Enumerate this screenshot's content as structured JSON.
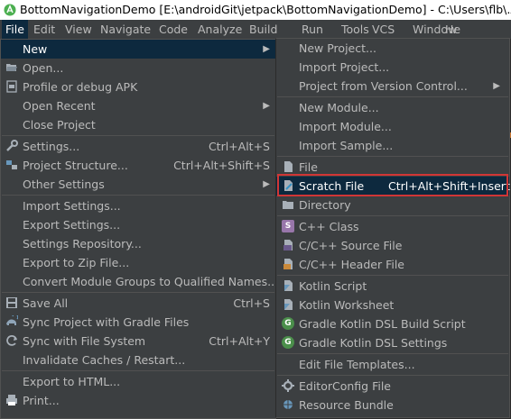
{
  "window": {
    "title": "BottomNavigationDemo [E:\\androidGit\\jetpack\\BottomNavigationDemo] - C:\\Users\\flb\\.Andro"
  },
  "menubar": {
    "items": [
      "File",
      "Edit",
      "View",
      "Navigate",
      "Code",
      "Analyze",
      "Build",
      "Run",
      "Tools",
      "VCS",
      "Window",
      "He"
    ]
  },
  "file_menu": {
    "items": [
      {
        "label": "New",
        "icon": "none",
        "submenu": true
      },
      {
        "label": "Open...",
        "icon": "folder-open-icon"
      },
      {
        "label": "Profile or debug APK",
        "icon": "apk-icon"
      },
      {
        "label": "Open Recent",
        "icon": "none",
        "submenu": true
      },
      {
        "label": "Close Project",
        "icon": "none"
      },
      {
        "label": "Settings...",
        "icon": "wrench-icon",
        "shortcut": "Ctrl+Alt+S"
      },
      {
        "label": "Project Structure...",
        "icon": "project-structure-icon",
        "shortcut": "Ctrl+Alt+Shift+S"
      },
      {
        "label": "Other Settings",
        "icon": "none",
        "submenu": true
      },
      {
        "label": "Import Settings...",
        "icon": "none"
      },
      {
        "label": "Export Settings...",
        "icon": "none"
      },
      {
        "label": "Settings Repository...",
        "icon": "none"
      },
      {
        "label": "Export to Zip File...",
        "icon": "none"
      },
      {
        "label": "Convert Module Groups to Qualified Names...",
        "icon": "none"
      },
      {
        "label": "Save All",
        "icon": "save-icon",
        "shortcut": "Ctrl+S"
      },
      {
        "label": "Sync Project with Gradle Files",
        "icon": "gradle-sync-icon"
      },
      {
        "label": "Sync with File System",
        "icon": "refresh-icon",
        "shortcut": "Ctrl+Alt+Y"
      },
      {
        "label": "Invalidate Caches / Restart...",
        "icon": "none"
      },
      {
        "label": "Export to HTML...",
        "icon": "none"
      },
      {
        "label": "Print...",
        "icon": "print-icon"
      }
    ]
  },
  "new_menu": {
    "items": [
      {
        "label": "New Project...",
        "icon": "none"
      },
      {
        "label": "Import Project...",
        "icon": "none"
      },
      {
        "label": "Project from Version Control...",
        "icon": "none",
        "submenu": true
      },
      {
        "label": "New Module...",
        "icon": "none"
      },
      {
        "label": "Import Module...",
        "icon": "none"
      },
      {
        "label": "Import Sample...",
        "icon": "none"
      },
      {
        "label": "File",
        "icon": "file-icon"
      },
      {
        "label": "Scratch File",
        "icon": "scratch-file-icon",
        "shortcut": "Ctrl+Alt+Shift+Insert"
      },
      {
        "label": "Directory",
        "icon": "directory-icon"
      },
      {
        "label": "C++ Class",
        "icon": "cpp-class-icon"
      },
      {
        "label": "C/C++ Source File",
        "icon": "cpp-source-icon"
      },
      {
        "label": "C/C++ Header File",
        "icon": "cpp-header-icon"
      },
      {
        "label": "Kotlin Script",
        "icon": "kotlin-script-icon"
      },
      {
        "label": "Kotlin Worksheet",
        "icon": "kotlin-worksheet-icon"
      },
      {
        "label": "Gradle Kotlin DSL Build Script",
        "icon": "gradle-kotlin-icon"
      },
      {
        "label": "Gradle Kotlin DSL Settings",
        "icon": "gradle-kotlin-icon"
      },
      {
        "label": "Edit File Templates...",
        "icon": "none"
      },
      {
        "label": "EditorConfig File",
        "icon": "editorconfig-icon"
      },
      {
        "label": "Resource Bundle",
        "icon": "resource-bundle-icon"
      }
    ]
  },
  "colors": {
    "menu_bg": "#3c3f41",
    "highlight": "#0d293e",
    "text": "#bbbbbb",
    "annotation_box": "#d03636"
  }
}
